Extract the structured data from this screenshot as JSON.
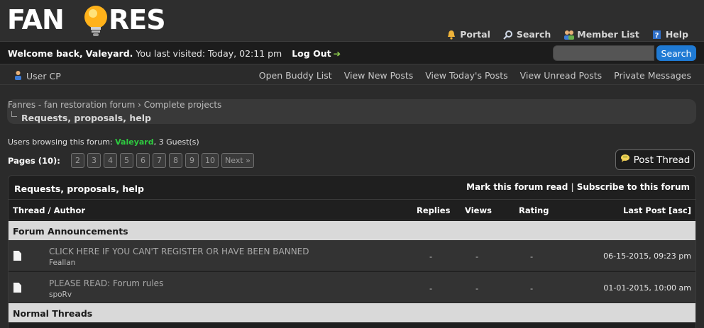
{
  "header": {
    "logo_text": "FANRES",
    "nav": [
      {
        "label": "Portal",
        "icon": "bell-icon"
      },
      {
        "label": "Search",
        "icon": "magnifier-icon"
      },
      {
        "label": "Member List",
        "icon": "members-icon"
      },
      {
        "label": "Help",
        "icon": "help-book-icon"
      }
    ]
  },
  "welcome": {
    "prefix": "Welcome back,",
    "username": "Valeyard.",
    "visited": "You last visited: Today, 02:11 pm",
    "logout": "Log Out",
    "search_value": "",
    "search_button": "Search"
  },
  "usercp": {
    "label": "User CP",
    "links": [
      "Open Buddy List",
      "View New Posts",
      "View Today's Posts",
      "View Unread Posts",
      "Private Messages"
    ]
  },
  "breadcrumb": {
    "parent1": "Fanres - fan restoration forum",
    "separator": "›",
    "parent2": "Complete projects",
    "current": "Requests, proposals, help"
  },
  "browsing": {
    "prefix": "Users browsing this forum:",
    "user": "Valeyard",
    "suffix": ", 3 Guest(s)"
  },
  "pagination": {
    "label": "Pages (10):",
    "pages": [
      "2",
      "3",
      "4",
      "5",
      "6",
      "7",
      "8",
      "9",
      "10"
    ],
    "next": "Next »"
  },
  "post_thread_button": "Post Thread",
  "forum": {
    "title": "Requests, proposals, help",
    "mark_read": "Mark this forum read",
    "action_sep": "|",
    "subscribe": "Subscribe to this forum",
    "columns": {
      "thread": "Thread / Author",
      "replies": "Replies",
      "views": "Views",
      "rating": "Rating",
      "last_post": "Last Post [asc]"
    },
    "announcements_title": "Forum Announcements",
    "announcements": [
      {
        "title": "CLICK HERE IF YOU CAN'T REGISTER OR HAVE BEEN BANNED",
        "author": "Feallan",
        "replies": "-",
        "views": "-",
        "rating": "-",
        "last_post": "06-15-2015, 09:23 pm"
      },
      {
        "title": "PLEASE READ: Forum rules",
        "author": "spoRv",
        "replies": "-",
        "views": "-",
        "rating": "-",
        "last_post": "01-01-2015, 10:00 am"
      }
    ],
    "normal_title": "Normal Threads"
  },
  "colors": {
    "accent_search": "#1f7ad4",
    "online_user": "#2ecc40",
    "section_bg": "#d9d9d9"
  }
}
